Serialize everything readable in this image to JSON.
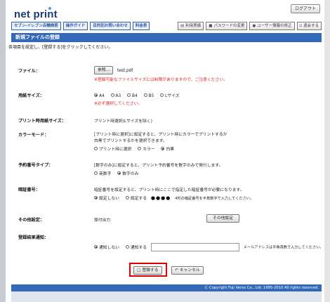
{
  "header": {
    "logo": "net print",
    "logout_label": "ログアウト"
  },
  "nav": {
    "left": [
      "セブン-イレブン店舗検索",
      "操作ガイド",
      "目的別お問い合わせ",
      "料金表"
    ],
    "right": [
      {
        "icon": "history-icon",
        "glyph": "▤",
        "label": "利用実績"
      },
      {
        "icon": "lock-icon",
        "glyph": "■",
        "label": "パスワードの変更"
      },
      {
        "icon": "user-icon",
        "glyph": "●",
        "label": "ユーザー情報の修正"
      },
      {
        "icon": "exit-icon",
        "glyph": "⍈",
        "label": "退会する"
      }
    ]
  },
  "title": "新規ファイルの登録",
  "instruction": "各項目を設定し、[登録する]をクリックしてください。",
  "file": {
    "label": "ファイル：",
    "browse_label": "参照...",
    "filename": "test.pdf",
    "warning": "※登録可能なファイルサイズには制限がありますので、ご注意ください。"
  },
  "paper_size": {
    "label": "用紙サイズ：",
    "options": [
      "A4",
      "A3",
      "B4",
      "B5",
      "Lサイズ"
    ],
    "selected_index": 0,
    "note": "※必ず選択してください。"
  },
  "print_paper_size": {
    "label": "プリント時用紙サイズ：",
    "value": "プリント時選択(Lサイズを除く)"
  },
  "color_mode": {
    "label": "カラーモード：",
    "desc1": "[プリント時に選択]に設定すると、プリント時にカラーでプリントするか",
    "desc2": "白黒でプリントするかを選択できます。",
    "options": [
      "プリント時に選択",
      "カラー",
      "白黒"
    ],
    "selected_index": 2
  },
  "reservation_type": {
    "label": "予約番号タイプ：",
    "desc": "[数字のみ]に設定すると、プリント予約番号を数字のみで発行します。",
    "options": [
      "英数字",
      "数字のみ"
    ],
    "selected_index": 1
  },
  "pin": {
    "label": "暗証番号：",
    "desc": "暗証番号を設定すると、プリント時にここで指定した暗証番号が必要になります。",
    "options": [
      "設定しない",
      "設定する"
    ],
    "selected_index": 0,
    "masked": "●●●●",
    "hint": "4桁の暗証番号を半角数字で入力してください。"
  },
  "other": {
    "label": "その他設定：",
    "value": "厚付出力",
    "button": "その他設定"
  },
  "notify": {
    "label": "登録結果通知：",
    "options": [
      "通知しない",
      "通知する"
    ],
    "selected_index": 0,
    "email_value": "",
    "hint": "メールアドレスは半角英数で入力してください。"
  },
  "actions": {
    "register_label": "登録する",
    "cancel_label": "キャンセル"
  },
  "copyright": "Ⓒ Copyright Fuji Xerox Co., Ltd. 1995-2010 All rights reserved."
}
